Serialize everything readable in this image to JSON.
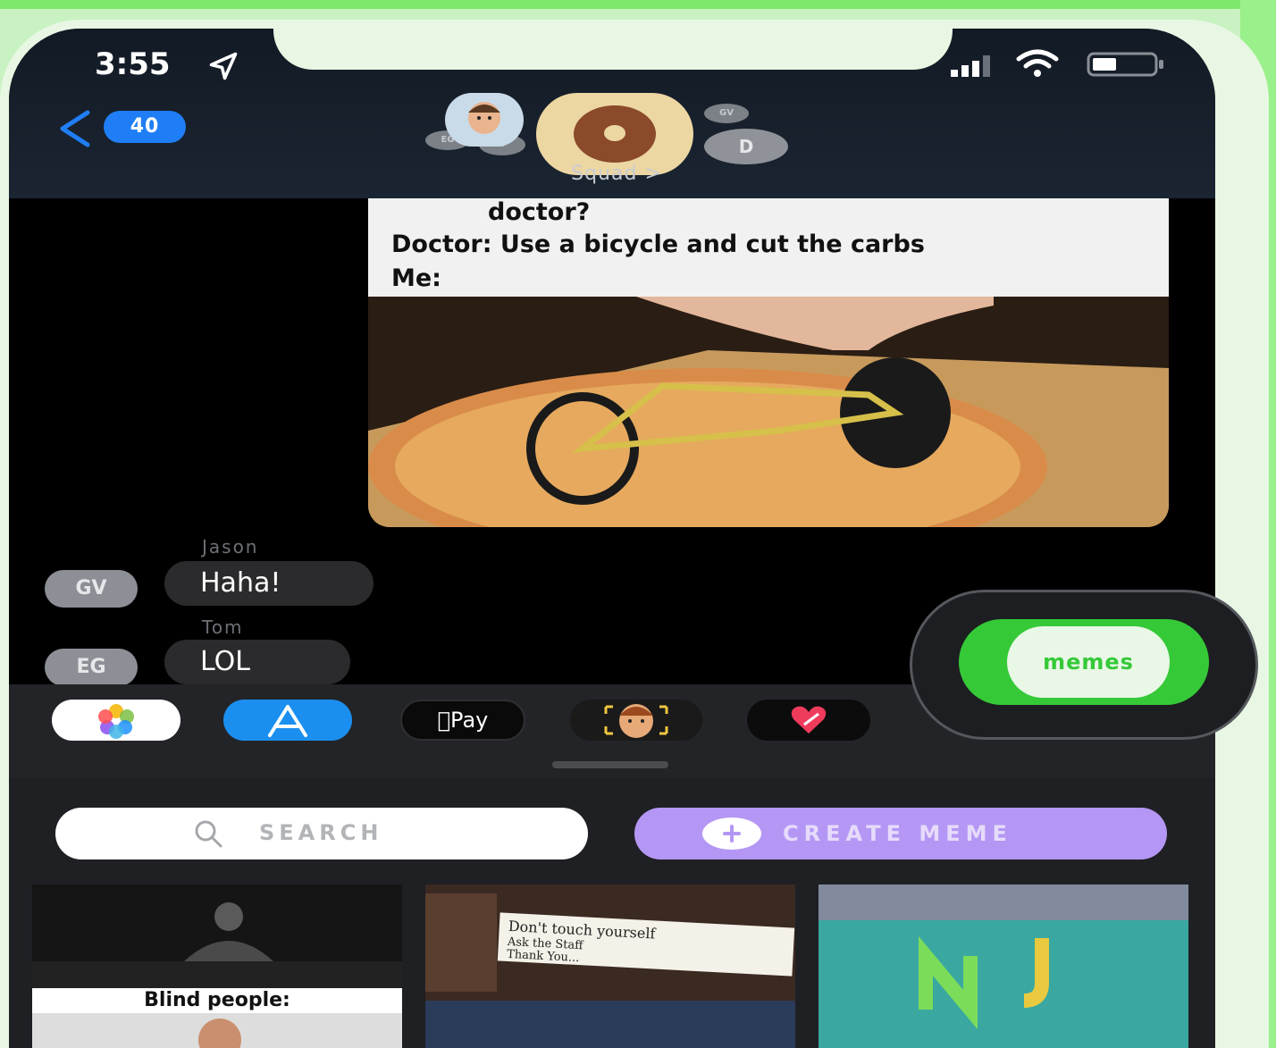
{
  "status_bar": {
    "time": "3:55"
  },
  "header": {
    "back_badge": "40",
    "group_name": "Squad >"
  },
  "participants": [
    "EG",
    "D",
    "GV",
    "D"
  ],
  "meme": {
    "lines": [
      "doctor?",
      "Doctor: Use a bicycle and cut the carbs",
      "Me:"
    ]
  },
  "messages": [
    {
      "sender": "Jason",
      "avatar": "GV",
      "text": "Haha!"
    },
    {
      "sender": "Tom",
      "avatar": "EG",
      "text": "LOL"
    }
  ],
  "app_strip": {
    "apple_pay_label": "Pay",
    "memes_label": "memes"
  },
  "drawer": {
    "search_placeholder": "SEARCH",
    "create_label": "CREATE MEME",
    "thumbs": [
      {
        "caption": "Blind people:"
      },
      {
        "note_line1": "Don't touch yourself",
        "note_line2": "Ask the Staff",
        "note_line3": "Thank You..."
      },
      {
        "caption": ""
      }
    ]
  },
  "colors": {
    "accent_blue": "#1f7ef5",
    "memes_green": "#35c938",
    "create_purple": "#b497f4"
  }
}
